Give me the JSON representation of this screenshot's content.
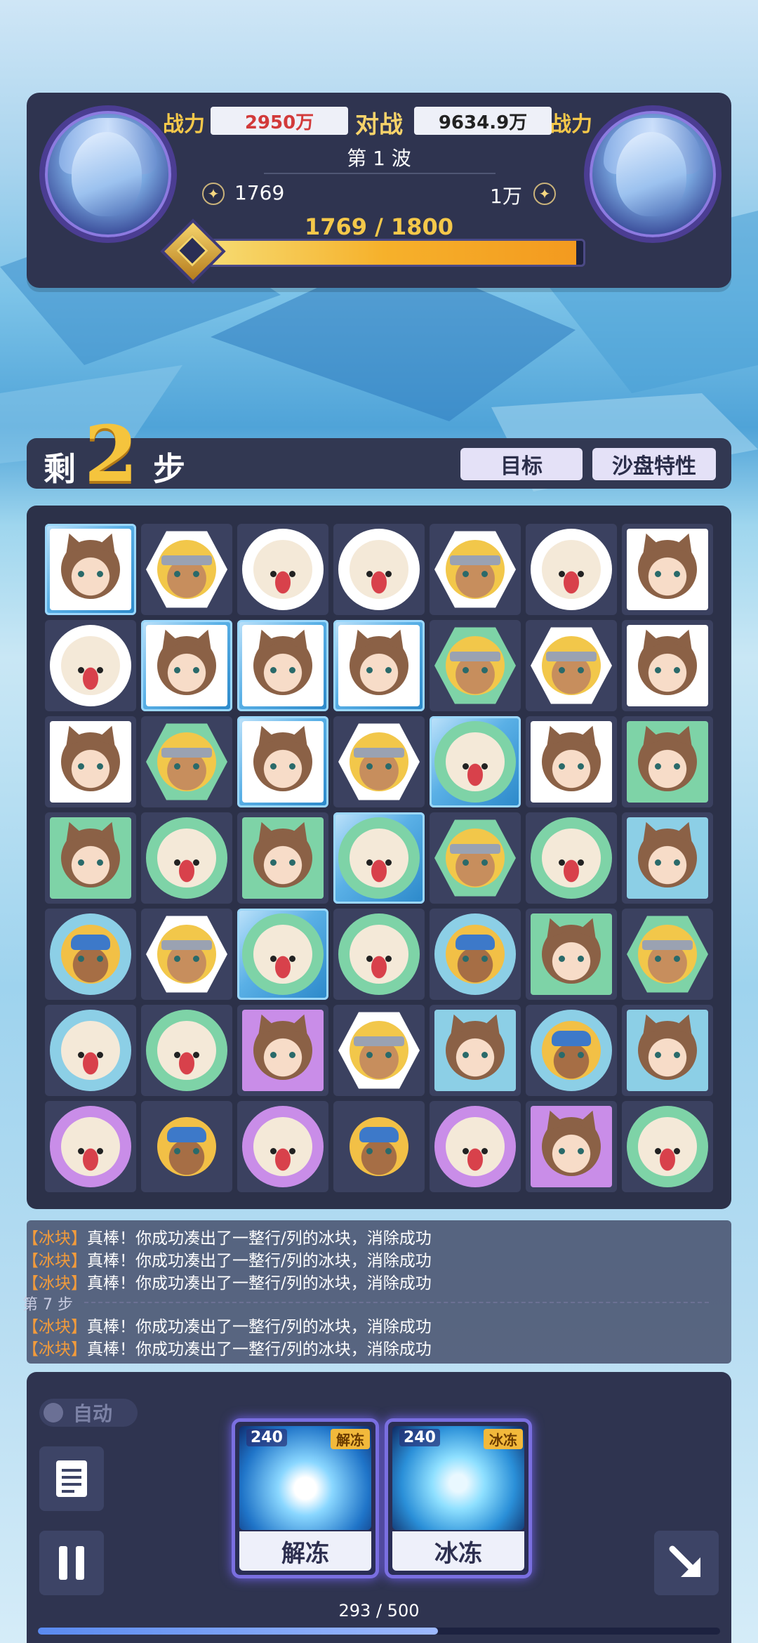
{
  "header": {
    "left_power_label": "战力",
    "left_power_value": "2950万",
    "vs_label": "对战",
    "right_power_value": "9634.9万",
    "right_power_label": "战力",
    "wave_label": "第 1 波",
    "left_currency": "1769",
    "right_currency": "1万",
    "progress_text": "1769 / 1800",
    "progress_fraction": 0.983
  },
  "steps": {
    "prefix": "剩",
    "count": "2",
    "suffix": "步",
    "target_button": "目标",
    "traits_button": "沙盘特性"
  },
  "board": {
    "rows": [
      [
        {
          "f": "cat",
          "s": "square",
          "c": "white",
          "ice": true
        },
        {
          "f": "girl",
          "s": "hex",
          "c": "white"
        },
        {
          "f": "dog",
          "s": "circle",
          "c": "white"
        },
        {
          "f": "dog",
          "s": "circle",
          "c": "white"
        },
        {
          "f": "girl",
          "s": "hex",
          "c": "white"
        },
        {
          "f": "dog",
          "s": "circle",
          "c": "white"
        },
        {
          "f": "cat",
          "s": "square",
          "c": "white"
        }
      ],
      [
        {
          "f": "dog",
          "s": "circle",
          "c": "white"
        },
        {
          "f": "cat",
          "s": "square",
          "c": "white",
          "ice": true
        },
        {
          "f": "cat",
          "s": "square",
          "c": "white",
          "ice": true
        },
        {
          "f": "cat",
          "s": "square",
          "c": "white",
          "ice": true
        },
        {
          "f": "girl",
          "s": "hex",
          "c": "green"
        },
        {
          "f": "girl",
          "s": "hex",
          "c": "white"
        },
        {
          "f": "cat",
          "s": "square",
          "c": "white"
        }
      ],
      [
        {
          "f": "cat",
          "s": "square",
          "c": "white"
        },
        {
          "f": "girl",
          "s": "hex",
          "c": "green"
        },
        {
          "f": "cat",
          "s": "square",
          "c": "white",
          "ice": true
        },
        {
          "f": "girl",
          "s": "hex",
          "c": "white"
        },
        {
          "f": "dog",
          "s": "circle",
          "c": "green",
          "ice": true
        },
        {
          "f": "cat",
          "s": "square",
          "c": "white"
        },
        {
          "f": "cat",
          "s": "square",
          "c": "green"
        }
      ],
      [
        {
          "f": "cat",
          "s": "square",
          "c": "green"
        },
        {
          "f": "dog",
          "s": "circle",
          "c": "green"
        },
        {
          "f": "cat",
          "s": "square",
          "c": "green"
        },
        {
          "f": "dog",
          "s": "circle",
          "c": "green",
          "ice": true
        },
        {
          "f": "girl",
          "s": "hex",
          "c": "green"
        },
        {
          "f": "dog",
          "s": "circle",
          "c": "green"
        },
        {
          "f": "cat",
          "s": "square",
          "c": "blue"
        }
      ],
      [
        {
          "f": "helm",
          "s": "circle",
          "c": "blue"
        },
        {
          "f": "girl",
          "s": "hex",
          "c": "white"
        },
        {
          "f": "dog",
          "s": "circle",
          "c": "green",
          "ice": true
        },
        {
          "f": "dog",
          "s": "circle",
          "c": "green"
        },
        {
          "f": "helm",
          "s": "circle",
          "c": "blue"
        },
        {
          "f": "cat",
          "s": "square",
          "c": "green"
        },
        {
          "f": "girl",
          "s": "hex",
          "c": "green"
        }
      ],
      [
        {
          "f": "dog",
          "s": "circle",
          "c": "blue"
        },
        {
          "f": "dog",
          "s": "circle",
          "c": "green"
        },
        {
          "f": "cat",
          "s": "square",
          "c": "purple"
        },
        {
          "f": "girl",
          "s": "hex",
          "c": "white"
        },
        {
          "f": "cat",
          "s": "square",
          "c": "blue"
        },
        {
          "f": "helm",
          "s": "circle",
          "c": "blue"
        },
        {
          "f": "cat",
          "s": "square",
          "c": "blue"
        }
      ],
      [
        {
          "f": "dog",
          "s": "circle",
          "c": "purple"
        },
        {
          "f": "helm",
          "s": "none",
          "c": "none"
        },
        {
          "f": "dog",
          "s": "circle",
          "c": "purple"
        },
        {
          "f": "helm",
          "s": "none",
          "c": "none"
        },
        {
          "f": "dog",
          "s": "circle",
          "c": "purple"
        },
        {
          "f": "cat",
          "s": "square",
          "c": "purple"
        },
        {
          "f": "dog",
          "s": "circle",
          "c": "green"
        }
      ]
    ]
  },
  "log": {
    "lines": [
      {
        "tag": "【冰块】",
        "text": "真棒！你成功凑出了一整行/列的冰块，消除成功"
      },
      {
        "tag": "【冰块】",
        "text": "真棒！你成功凑出了一整行/列的冰块，消除成功"
      },
      {
        "tag": "【冰块】",
        "text": "真棒！你成功凑出了一整行/列的冰块，消除成功"
      },
      {
        "tag": "【冰块】",
        "text": "真棒！你成功凑出了一整行/列的冰块，消除成功"
      },
      {
        "tag": "【冰块】",
        "text": "真棒！你成功凑出了一整行/列的冰块，消除成功"
      }
    ],
    "step_label": "第 7 步"
  },
  "controls": {
    "auto_label": "自动",
    "skills": [
      {
        "cost": "240",
        "tag": "解冻",
        "name": "解冻"
      },
      {
        "cost": "240",
        "tag": "冰冻",
        "name": "冰冻"
      }
    ],
    "energy_text": "293 / 500",
    "energy_fraction": 0.586
  },
  "icons": {
    "currency": "gem-icon",
    "log": "document-icon",
    "pause": "pause-icon",
    "corner": "arrow-down-right-icon"
  }
}
